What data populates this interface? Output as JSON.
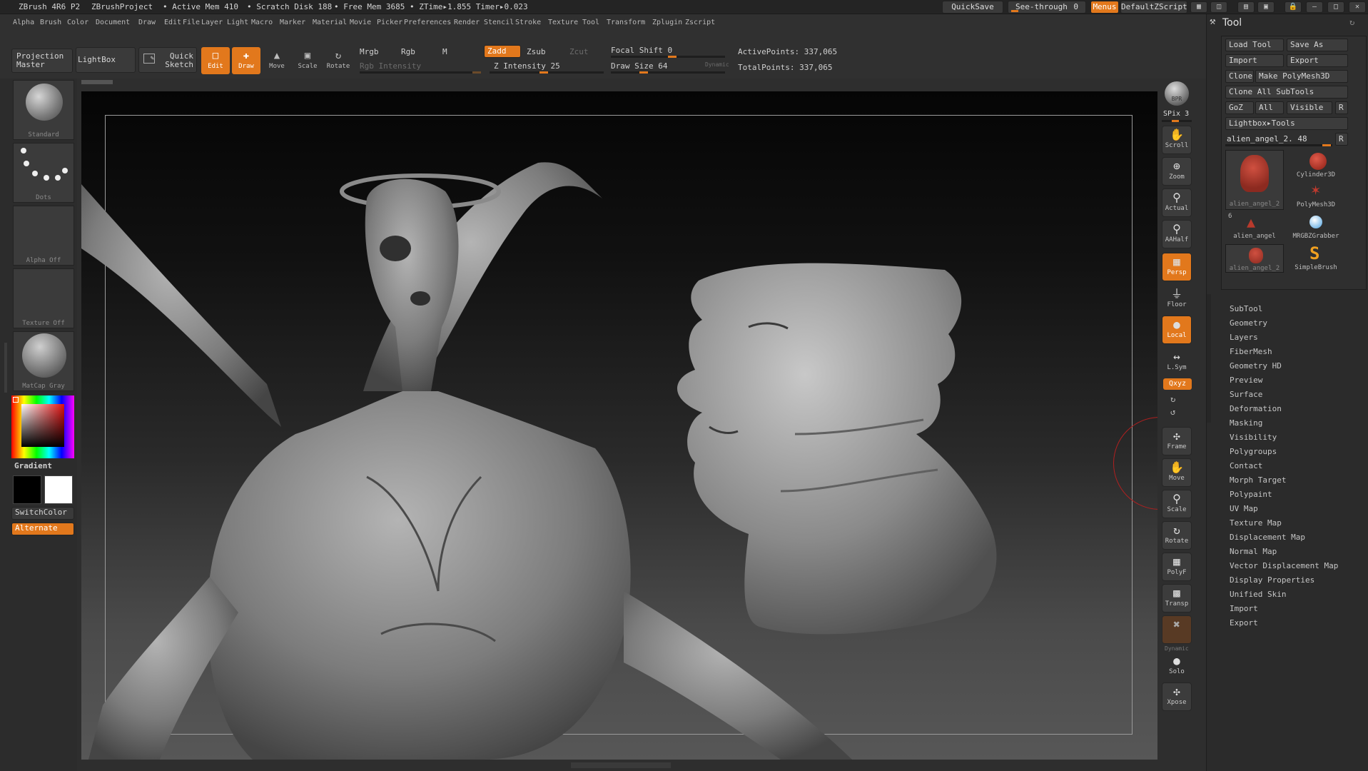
{
  "titlebar": {
    "app": "ZBrush 4R6 P2",
    "project": "ZBrushProject",
    "active_mem": "• Active Mem 410",
    "scratch_disk": "• Scratch Disk 188",
    "free_mem": "• Free Mem 3685",
    "ztime": "• ZTime▸1.855 Timer▸0.023",
    "quicksave": "QuickSave",
    "seethrough": "See-through",
    "seethrough_value": "0",
    "menus": "Menus",
    "script": "DefaultZScript"
  },
  "menubar": [
    "Alpha",
    "Brush",
    "Color",
    "Document",
    "Draw",
    "Edit",
    "File",
    "Layer",
    "Light",
    "Macro",
    "Marker",
    "Material",
    "Movie",
    "Picker",
    "Preferences",
    "Render",
    "Stencil",
    "Stroke",
    "Texture",
    "Tool",
    "Transform",
    "Zplugin",
    "Zscript"
  ],
  "shelf": {
    "projection_master": "Projection Master",
    "lightbox": "LightBox",
    "quick_sketch": "Quick Sketch",
    "edit": "Edit",
    "draw": "Draw",
    "move": "Move",
    "scale": "Scale",
    "rotate": "Rotate",
    "mrgb": "Mrgb",
    "rgb": "Rgb",
    "m": "M",
    "rgb_intensity": "Rgb Intensity",
    "zadd": "Zadd",
    "zsub": "Zsub",
    "zcut": "Zcut",
    "z_intensity": "Z Intensity 25",
    "focal_shift": "Focal Shift 0",
    "draw_size": "Draw Size 64",
    "dynamic": "Dynamic",
    "active_points": "ActivePoints: 337,065",
    "total_points": "TotalPoints: 337,065"
  },
  "left": {
    "brush": "Standard",
    "stroke": "Dots",
    "alpha": "Alpha Off",
    "texture": "Texture Off",
    "material": "MatCap Gray",
    "gradient": "Gradient",
    "switchcolor": "SwitchColor",
    "alternate": "Alternate"
  },
  "rightcol": {
    "bpr": "BPR",
    "spix": "SPix 3",
    "scroll": "Scroll",
    "zoom": "Zoom",
    "actual": "Actual",
    "aahalf": "AAHalf",
    "persp": "Persp",
    "floor": "Floor",
    "local": "Local",
    "lsym": "L.Sym",
    "qxyz": "Qxyz",
    "frame": "Frame",
    "move": "Move",
    "scale": "Scale",
    "rotate": "Rotate",
    "polyf": "PolyF",
    "transp": "Transp",
    "dynamic": "Dynamic",
    "solo": "Solo",
    "xpose": "Xpose"
  },
  "toolpanel": {
    "title": "Tool",
    "load_tool": "Load Tool",
    "save_as": "Save As",
    "import": "Import",
    "export": "Export",
    "clone": "Clone",
    "make_polymesh": "Make PolyMesh3D",
    "clone_all": "Clone All SubTools",
    "goz": "GoZ",
    "all": "All",
    "visible": "Visible",
    "r": "R",
    "lightbox_tools": "Lightbox▸Tools",
    "current_tool": "alien_angel_2. 48",
    "thumbs": [
      {
        "label": "alien_angel_2"
      },
      {
        "label": "Cylinder3D"
      },
      {
        "label": "PolyMesh3D"
      },
      {
        "label": "alien_angel"
      },
      {
        "label": "MRGBZGrabber"
      },
      {
        "label": "alien_angel_2"
      },
      {
        "label": "SimpleBrush"
      }
    ],
    "count_badge": "6",
    "subpalettes": [
      "SubTool",
      "Geometry",
      "Layers",
      "FiberMesh",
      "Geometry HD",
      "Preview",
      "Surface",
      "Deformation",
      "Masking",
      "Visibility",
      "Polygroups",
      "Contact",
      "Morph Target",
      "Polypaint",
      "UV Map",
      "Texture Map",
      "Displacement Map",
      "Normal Map",
      "Vector Displacement Map",
      "Display Properties",
      "Unified Skin",
      "Import",
      "Export"
    ]
  },
  "colors": {
    "accent": "#e2781c",
    "panel": "#2b2b2b",
    "button": "#3c3c3c"
  }
}
